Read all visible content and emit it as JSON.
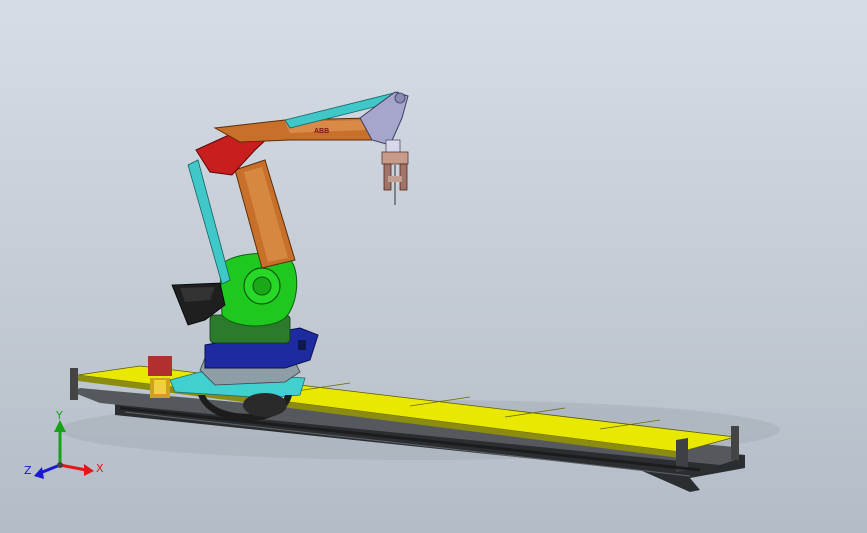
{
  "colors": {
    "background_top": "#d6dde6",
    "background_bottom": "#b3bcc7",
    "track_plate": "#e8e800",
    "track_rail": "#3a3d40",
    "base_blue": "#1e2aa0",
    "turret_green": "#1ec81e",
    "arm_orange": "#c8702a",
    "arm_red": "#c81e1e",
    "link_cyan": "#40c8c8",
    "wrist_lavender": "#a6a6cc",
    "gripper_pink": "#c89a8a",
    "counterweight_black": "#202020"
  },
  "model": {
    "brand_marking": "ABB"
  },
  "triad": {
    "x_label": "X",
    "y_label": "Y",
    "z_label": "Z",
    "x_color": "#e01818",
    "y_color": "#18a018",
    "z_color": "#1818d0"
  }
}
